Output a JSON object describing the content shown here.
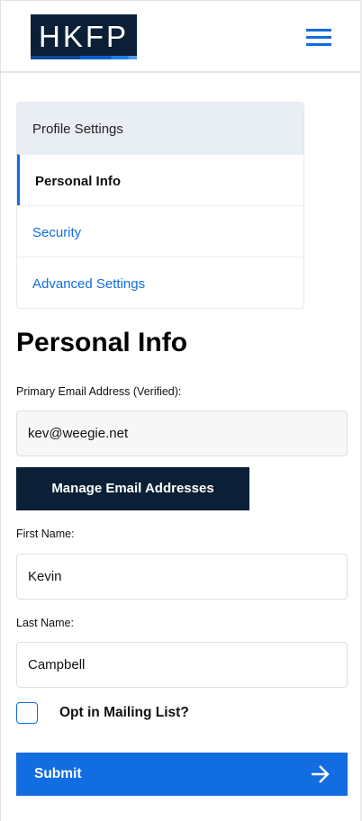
{
  "header": {
    "logo_text": "HKFP",
    "menu_icon": "hamburger-icon"
  },
  "sidebar": {
    "title": "Profile Settings",
    "items": [
      {
        "label": "Personal Info",
        "active": true
      },
      {
        "label": "Security"
      },
      {
        "label": "Advanced Settings"
      }
    ]
  },
  "main": {
    "title": "Personal Info",
    "email_label": "Primary Email Address (Verified):",
    "email_value": "kev@weegie.net",
    "manage_label": "Manage Email Addresses",
    "first_label": "First Name:",
    "first_value": "Kevin",
    "last_label": "Last Name:",
    "last_value": "Campbell",
    "mailing_label": "Opt in Mailing List?",
    "mailing_checked": false,
    "submit_label": "Submit"
  },
  "colors": {
    "accent": "#116de0",
    "navy": "#0b2036"
  }
}
